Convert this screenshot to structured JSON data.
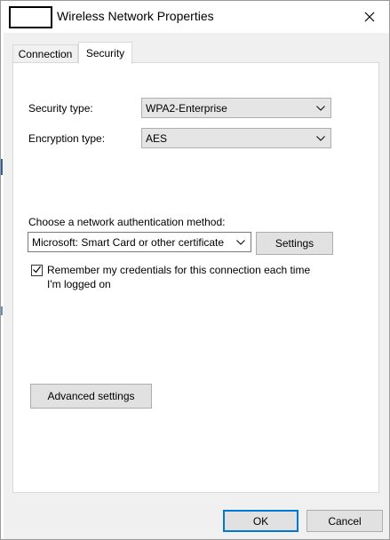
{
  "window": {
    "title": "Wireless Network Properties",
    "close_icon": "close-icon"
  },
  "tabs": [
    {
      "label": "Connection",
      "selected": false
    },
    {
      "label": "Security",
      "selected": true
    }
  ],
  "security": {
    "security_type_label": "Security type:",
    "security_type_value": "WPA2-Enterprise",
    "encryption_type_label": "Encryption type:",
    "encryption_type_value": "AES",
    "auth_method_label": "Choose a network authentication method:",
    "auth_method_value": "Microsoft: Smart Card or other certificate",
    "settings_button": "Settings",
    "remember_credentials": {
      "label": "Remember my credentials for this connection each time I'm logged on",
      "checked": true
    },
    "advanced_button": "Advanced settings"
  },
  "footer": {
    "ok_button": "OK",
    "cancel_button": "Cancel"
  },
  "colors": {
    "focus_border": "#0078d7",
    "panel_bg": "#ffffff",
    "dialog_bg": "#f0f0f0"
  }
}
